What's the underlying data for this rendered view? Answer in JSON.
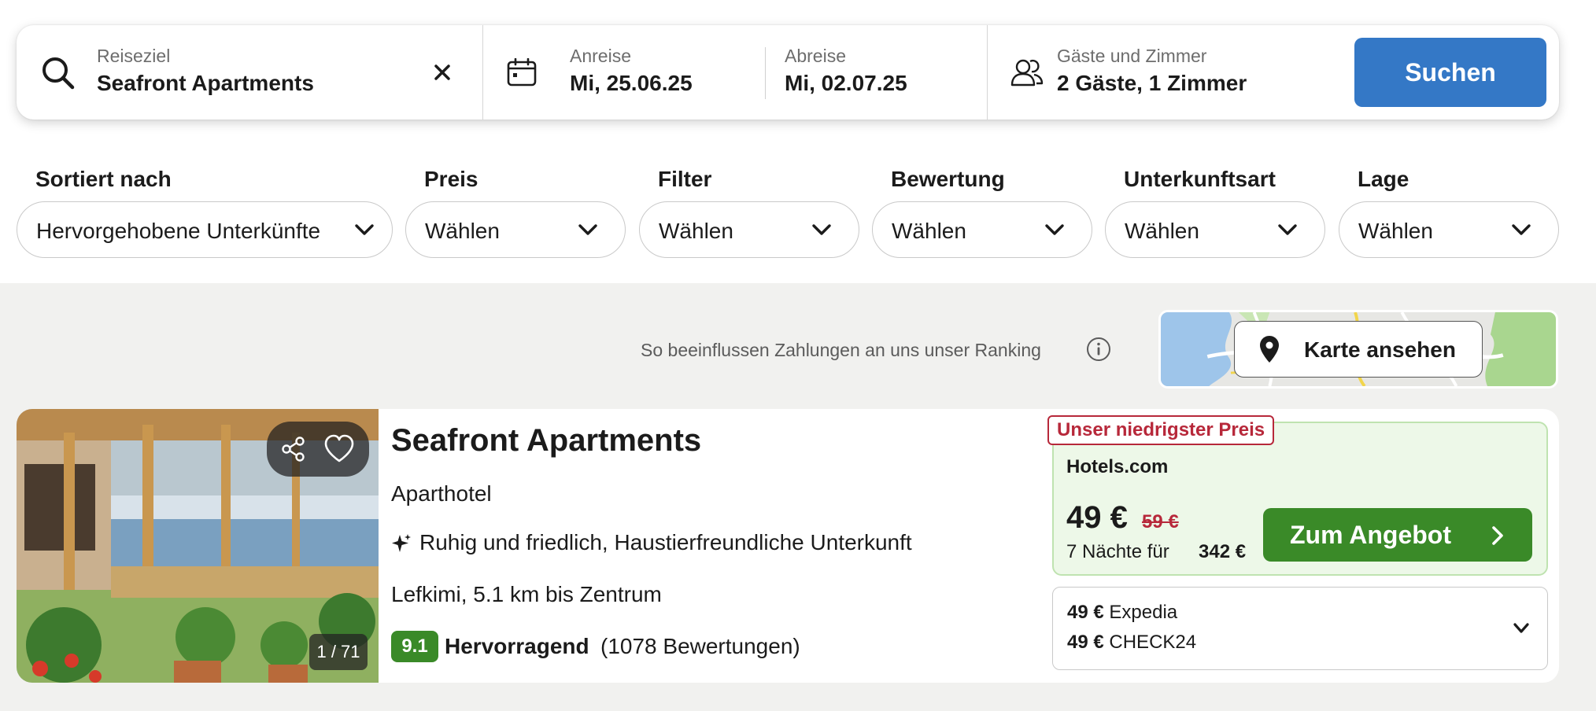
{
  "search": {
    "destination": {
      "label": "Reiseziel",
      "value": "Seafront Apartments",
      "clear_icon": "close-icon"
    },
    "checkin": {
      "label": "Anreise",
      "value": "Mi, 25.06.25"
    },
    "checkout": {
      "label": "Abreise",
      "value": "Mi, 02.07.25"
    },
    "guests": {
      "label": "Gäste und Zimmer",
      "value": "2 Gäste, 1 Zimmer"
    },
    "button": "Suchen",
    "button_color": "#3478c6"
  },
  "filters": [
    {
      "label": "Sortiert nach",
      "value": "Hervorgehobene Unterkünfte"
    },
    {
      "label": "Preis",
      "value": "Wählen"
    },
    {
      "label": "Filter",
      "value": "Wählen"
    },
    {
      "label": "Bewertung",
      "value": "Wählen"
    },
    {
      "label": "Unterkunftsart",
      "value": "Wählen"
    },
    {
      "label": "Lage",
      "value": "Wählen"
    }
  ],
  "ranking_note": "So beeinflussen Zahlungen an uns unser Ranking",
  "map_button": "Karte ansehen",
  "hotel": {
    "name": "Seafront Apartments",
    "type": "Aparthotel",
    "features": "Ruhig und friedlich, Haustierfreundliche Unterkunft",
    "location": "Lefkimi, 5.1 km bis Zentrum",
    "score": "9.1",
    "score_word": "Hervorragend",
    "review_count": "(1078 Bewertungen)",
    "photo_counter": "1 / 71",
    "score_color": "#3a8a28"
  },
  "deal": {
    "badge": "Unser niedrigster Preis",
    "provider": "Hotels.com",
    "price": "49 €",
    "old_price": "59 €",
    "nights_text": "7 Nächte für",
    "total": "342 €",
    "button": "Zum Angebot",
    "badge_color": "#b7283a"
  },
  "other_offers": [
    {
      "price": "49 €",
      "provider": "Expedia"
    },
    {
      "price": "49 €",
      "provider": "CHECK24"
    }
  ]
}
